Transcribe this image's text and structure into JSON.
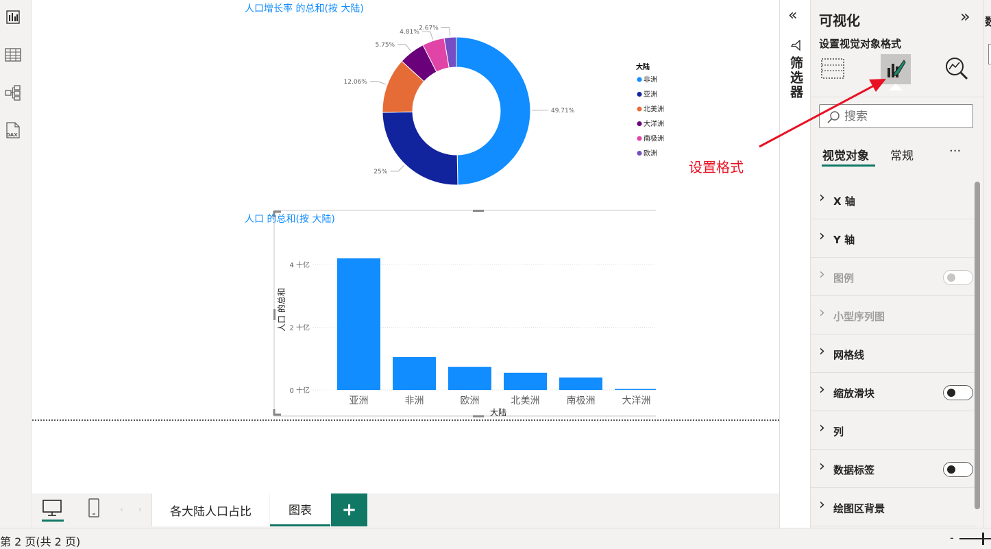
{
  "left_rail": {
    "icons": [
      "report-view-icon",
      "table-view-icon",
      "model-view-icon",
      "dax-query-icon"
    ],
    "dax_text": "DAX"
  },
  "charts": {
    "donut_title": "人口增长率 的总和(按 大陆)",
    "bar_title": "人口 的总和(按 大陆)"
  },
  "chart_data": [
    {
      "type": "pie",
      "title": "人口增长率 的总和(按 大陆)",
      "slices": [
        {
          "label": "非洲",
          "value": 49.71,
          "display": "49.71%",
          "color": "#118dff"
        },
        {
          "label": "亚洲",
          "value": 25.0,
          "display": "25%",
          "color": "#12239e"
        },
        {
          "label": "北美洲",
          "value": 12.06,
          "display": "12.06%",
          "color": "#e66c37"
        },
        {
          "label": "大洋洲",
          "value": 5.75,
          "display": "5.75%",
          "color": "#6b007b"
        },
        {
          "label": "南极洲",
          "value": 4.81,
          "display": "4.81%",
          "color": "#e044a7"
        },
        {
          "label": "欧洲",
          "value": 2.67,
          "display": "2.67%",
          "color": "#744ec2"
        }
      ],
      "legend_title": "大陆",
      "legend": [
        "非洲",
        "亚洲",
        "北美洲",
        "大洋洲",
        "南极洲",
        "欧洲"
      ],
      "legend_position": "right"
    },
    {
      "type": "bar",
      "title": "人口 的总和(按 大陆)",
      "categories": [
        "亚洲",
        "非洲",
        "欧洲",
        "北美洲",
        "南极洲",
        "大洋洲"
      ],
      "values": [
        4.2,
        1.05,
        0.74,
        0.55,
        0.4,
        0.03
      ],
      "unit": "十亿",
      "xlabel": "大陆",
      "ylabel": "人口 的总和",
      "yticks": [
        "0 十亿",
        "2 十亿",
        "4 十亿"
      ],
      "ylim": [
        0,
        4.7
      ],
      "color": "#118dff",
      "grid": true
    }
  ],
  "filter_pane": {
    "label": "筛选器",
    "collapse": "«"
  },
  "viz_pane": {
    "title": "可视化",
    "expand": "»",
    "subtitle": "设置视觉对象格式",
    "search_placeholder": "搜索",
    "tabs": [
      "视觉对象",
      "常规"
    ],
    "more": "···",
    "sections": [
      {
        "label": "X 轴",
        "toggle": null,
        "disabled": false
      },
      {
        "label": "Y 轴",
        "toggle": null,
        "disabled": false
      },
      {
        "label": "图例",
        "toggle": "off",
        "disabled": true
      },
      {
        "label": "小型序列图",
        "toggle": null,
        "disabled": true
      },
      {
        "label": "网格线",
        "toggle": null,
        "disabled": false
      },
      {
        "label": "缩放滑块",
        "toggle": "off",
        "disabled": false
      },
      {
        "label": "列",
        "toggle": null,
        "disabled": false
      },
      {
        "label": "数据标签",
        "toggle": "off",
        "disabled": false
      },
      {
        "label": "绘图区背景",
        "toggle": null,
        "disabled": false
      }
    ]
  },
  "right_strip": {
    "label": "数"
  },
  "pages": {
    "tabs": [
      "各大陆人口占比",
      "图表"
    ],
    "active": "图表",
    "add": "+"
  },
  "status": {
    "page": "第 2 页(共 2 页)",
    "zoom_minus": "-"
  },
  "annotation": {
    "label": "设置格式",
    "color": "#e81123"
  },
  "colors": {
    "accent": "#118dff",
    "brand": "#117865"
  }
}
